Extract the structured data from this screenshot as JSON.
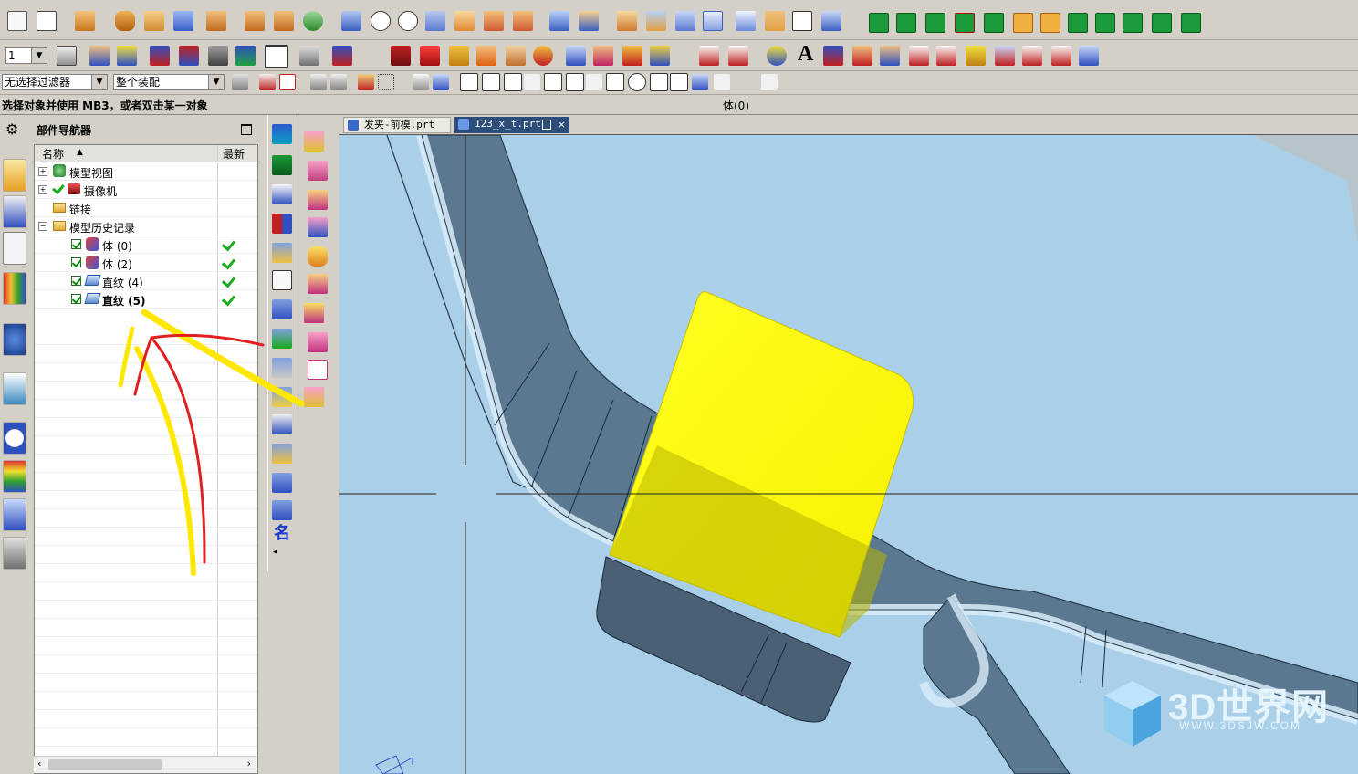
{
  "toolbar": {
    "layer_value": "1",
    "text_glyph": "A",
    "filter_select": "无选择过滤器",
    "assembly_select": "整个装配"
  },
  "status": {
    "prompt": "选择对象并使用 MB3，或者双击某一对象",
    "selection": "体(0)"
  },
  "navigator": {
    "title": "部件导航器",
    "columns": {
      "name": "名称",
      "latest": "最新"
    },
    "nodes": [
      {
        "label": "模型视图",
        "expander": "+",
        "icon": "model-views-icon"
      },
      {
        "label": "摄像机",
        "expander": "+",
        "icon": "camera-icon"
      },
      {
        "label": "链接",
        "expander": "",
        "icon": "folder-icon"
      },
      {
        "label": "模型历史记录",
        "expander": "−",
        "icon": "folder-icon"
      }
    ],
    "features": [
      {
        "label": "体 (0)",
        "icon": "body-feature-icon",
        "bold": false
      },
      {
        "label": "体 (2)",
        "icon": "body-feature-icon",
        "bold": false
      },
      {
        "label": "直纹 (4)",
        "icon": "ruled-surface-icon",
        "bold": false
      },
      {
        "label": "直纹 (5)",
        "icon": "ruled-surface-icon",
        "bold": true
      }
    ]
  },
  "left_strip_icons": [
    "settings-gear-icon",
    "assembly-navigator-icon",
    "constraint-navigator-icon",
    "part-navigator-icon",
    "reuse-library-icon",
    "info-icon",
    "document-icon",
    "history-clock-icon",
    "palette-icon",
    "roles-icon",
    "system-icon"
  ],
  "vertical_toolbar_1": {
    "name_glyph": "名"
  },
  "tabs": [
    {
      "label": "发夹-前模.prt",
      "active": false
    },
    {
      "label": "123_x_t.prt",
      "active": true
    }
  ],
  "watermark": {
    "brand": "3D世界网",
    "url": "WWW.3DSJW.COM"
  },
  "colors": {
    "ui_gray": "#d4d0c8",
    "viewport_bg": "#a9d0e8",
    "highlight": "#ffff00",
    "active_tab": "#2c4e7a",
    "check_green": "#1aaa1a",
    "annotation_red": "#e02020",
    "annotation_yellow": "#ffe800"
  }
}
